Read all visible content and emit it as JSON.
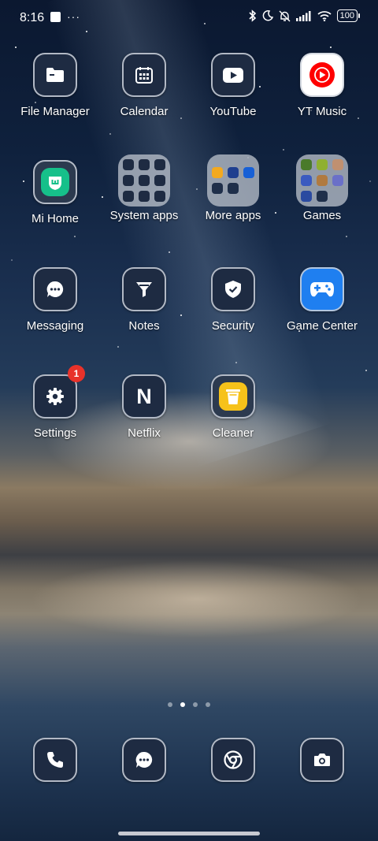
{
  "status_bar": {
    "time": "8:16",
    "battery": "100"
  },
  "apps": {
    "file_manager": "File Manager",
    "calendar": "Calendar",
    "youtube": "YouTube",
    "yt_music": "YT Music",
    "mi_home": "Mi Home",
    "system_apps": "System apps",
    "more_apps": "More apps",
    "games": "Games",
    "messaging": "Messaging",
    "notes": "Notes",
    "security": "Security",
    "game_center": "Game Center",
    "settings": "Settings",
    "settings_badge": "1",
    "netflix": "Netflix",
    "netflix_letter": "N",
    "cleaner": "Cleaner"
  },
  "pager": {
    "current_page": 2,
    "total_pages": 4
  },
  "dock": {
    "items": [
      "phone-icon",
      "messaging-icon",
      "chrome-icon",
      "camera-icon"
    ]
  },
  "colors": {
    "tile_bg": "#1e2b42",
    "badge": "#e8322a",
    "yt_music_red": "#ff0000",
    "mi_home_green": "#16c08a",
    "game_center_blue": "#1f7ff0",
    "cleaner_yellow": "#f6c21a"
  }
}
